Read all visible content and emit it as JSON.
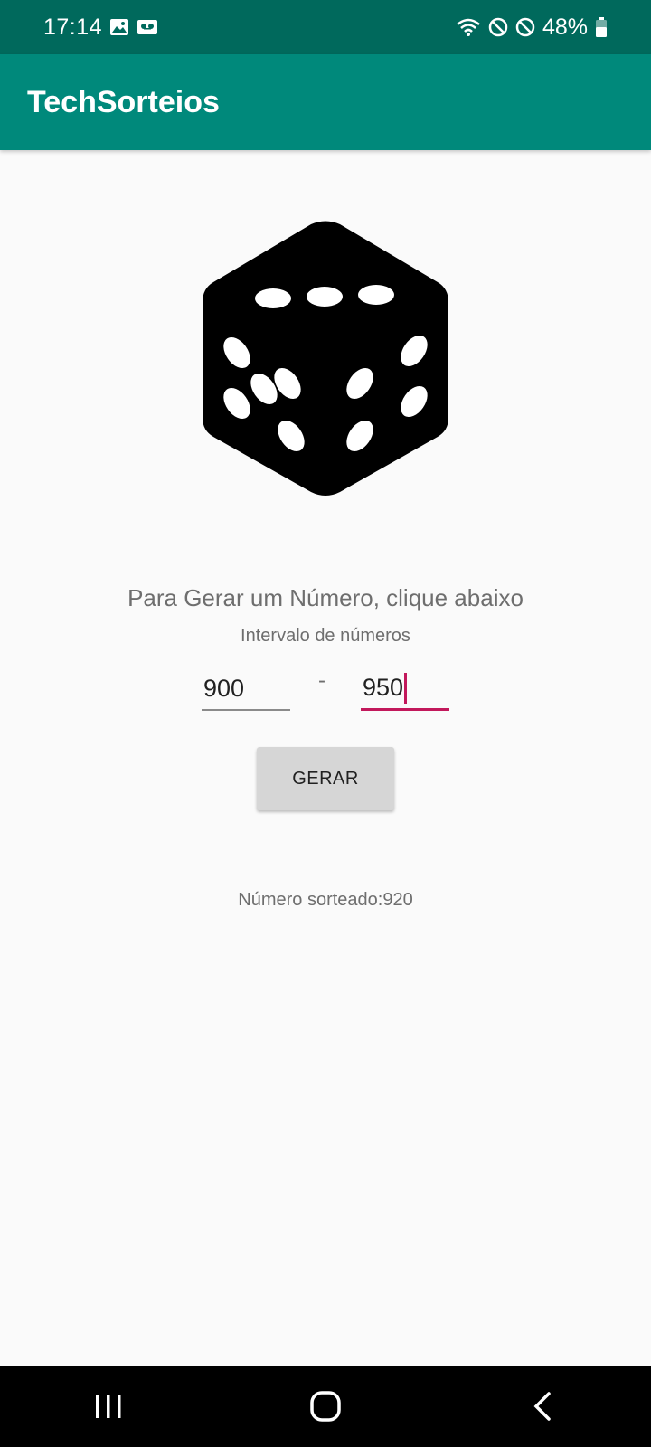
{
  "status_bar": {
    "time": "17:14",
    "battery": "48%",
    "icons": [
      "gallery-icon",
      "voicemail-icon",
      "wifi-icon",
      "do-not-disturb-icon",
      "blocked-icon",
      "battery-icon"
    ]
  },
  "app_bar": {
    "title": "TechSorteios",
    "color": "#00897b"
  },
  "main": {
    "image": "dice-icon",
    "instruction": "Para Gerar um Número, clique abaixo",
    "range_label": "Intervalo de números",
    "min_value": "900",
    "separator": "-",
    "max_value": "950",
    "button_label": "GERAR",
    "result_text": "Número sorteado:920",
    "accent_color": "#c2185b"
  },
  "nav_bar": {
    "items": [
      "recent-apps-icon",
      "home-icon",
      "back-icon"
    ]
  }
}
